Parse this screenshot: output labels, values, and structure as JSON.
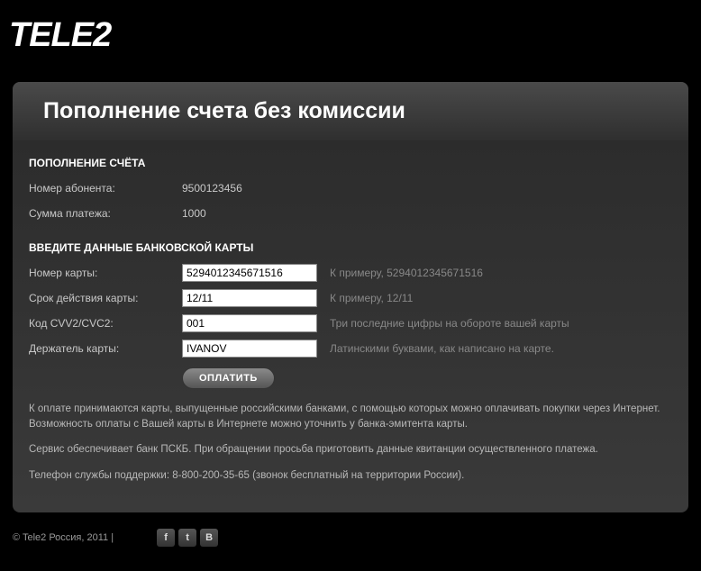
{
  "logo": "TELE2",
  "header": {
    "title": "Пополнение счета без комиссии"
  },
  "section1": {
    "title": "ПОПОЛНЕНИЕ СЧЁТА",
    "subscriber_label": "Номер абонента:",
    "subscriber_value": "9500123456",
    "amount_label": "Сумма платежа:",
    "amount_value": "1000"
  },
  "section2": {
    "title": "ВВЕДИТЕ ДАННЫЕ БАНКОВСКОЙ КАРТЫ",
    "card_label": "Номер карты:",
    "card_value": "5294012345671516",
    "card_hint": "К примеру, 5294012345671516",
    "expiry_label": "Срок действия карты:",
    "expiry_value": "12/11",
    "expiry_hint": "К примеру, 12/11",
    "cvv_label": "Код CVV2/CVC2:",
    "cvv_value": "001",
    "cvv_hint": "Три последние цифры на обороте вашей карты",
    "holder_label": "Держатель карты:",
    "holder_value": "IVANOV",
    "holder_hint": "Латинскими буквами, как написано на карте."
  },
  "pay_button": "ОПЛАТИТЬ",
  "notes": {
    "n1": "К оплате принимаются карты, выпущенные российскими банками, с помощью которых можно оплачивать покупки через Интернет. Возможность оплаты с Вашей карты в Интернете можно уточнить у банка-эмитента карты.",
    "n2": "Сервис обеспечивает банк ПСКБ. При обращении просьба приготовить данные квитанции осуществленного платежа.",
    "n3": "Телефон службы поддержки: 8-800-200-35-65 (звонок бесплатный на территории России)."
  },
  "footer": {
    "copyright": "© Tele2 Россия, 2011 |",
    "social": {
      "fb": "f",
      "tw": "t",
      "vk": "В"
    }
  }
}
